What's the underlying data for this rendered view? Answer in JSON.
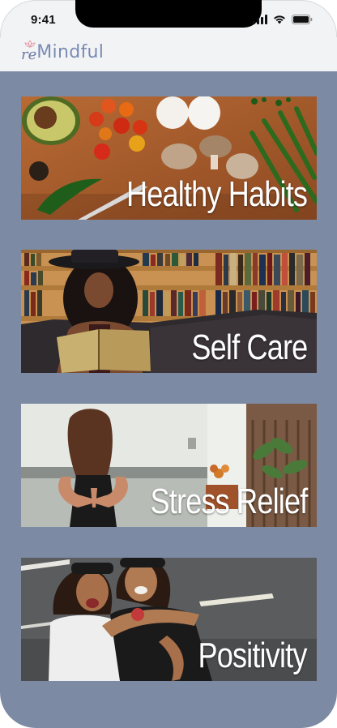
{
  "status_bar": {
    "time": "9:41"
  },
  "app": {
    "logo_prefix": "re",
    "logo_main": "Mindful"
  },
  "colors": {
    "background": "#7c8aa3",
    "logo": "#7a8bb4",
    "header": "#f2f3f4"
  },
  "categories": [
    {
      "label": "Healthy Habits"
    },
    {
      "label": "Self Care"
    },
    {
      "label": "Stress Relief"
    },
    {
      "label": "Positivity"
    }
  ]
}
